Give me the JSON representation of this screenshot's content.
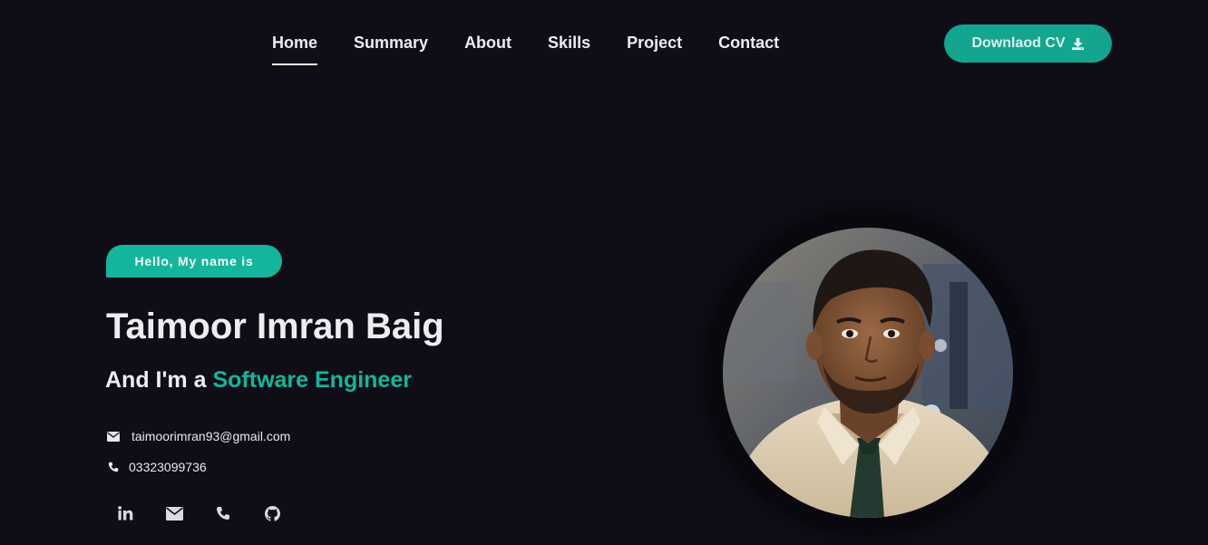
{
  "nav": {
    "items": [
      {
        "label": "Home",
        "active": true
      },
      {
        "label": "Summary"
      },
      {
        "label": "About"
      },
      {
        "label": "Skills"
      },
      {
        "label": "Project"
      },
      {
        "label": "Contact"
      }
    ],
    "cv_button": "Downlaod CV",
    "cv_icon": "download-icon"
  },
  "hero": {
    "greeting": "Hello, My name is",
    "name": "Taimoor Imran Baig",
    "role_prefix": "And I'm a",
    "role_highlight": "Software Engineer",
    "email": "taimoorimran93@gmail.com",
    "phone": "03323099736",
    "socials": [
      "linkedin-icon",
      "envelope-icon",
      "phone-icon",
      "github-icon"
    ]
  },
  "colors": {
    "background": "#0f0e17",
    "accent": "#14b59b",
    "button": "#14a58f",
    "text": "#ececf1"
  }
}
